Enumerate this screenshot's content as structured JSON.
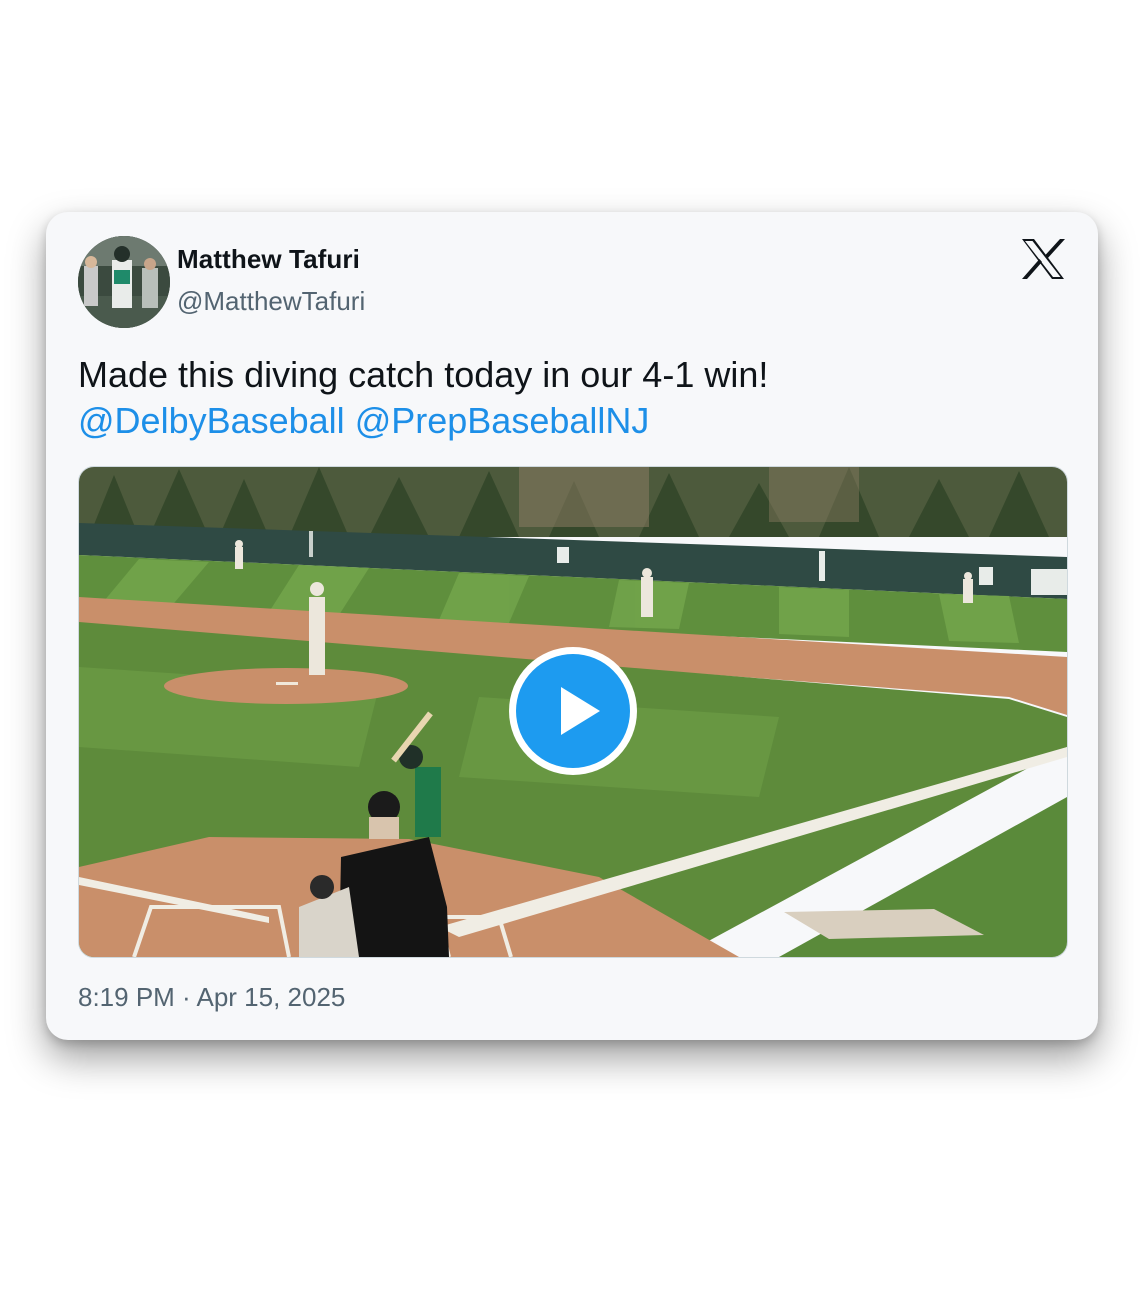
{
  "tweet": {
    "author_name": "Matthew Tafuri",
    "author_handle": "@MatthewTafuri",
    "text": "Made this diving catch today in our 4-1 win!",
    "mentions": [
      "@DelbyBaseball",
      "@PrepBaseballNJ"
    ],
    "timestamp": "8:19 PM · Apr 15, 2025",
    "media_type": "video"
  },
  "icons": {
    "platform_logo": "x-logo-icon",
    "play": "play-icon"
  },
  "colors": {
    "link": "#1d8fe8",
    "play_button": "#1d9bf0",
    "card_background": "#f7f8fa",
    "secondary_text": "#536471"
  }
}
